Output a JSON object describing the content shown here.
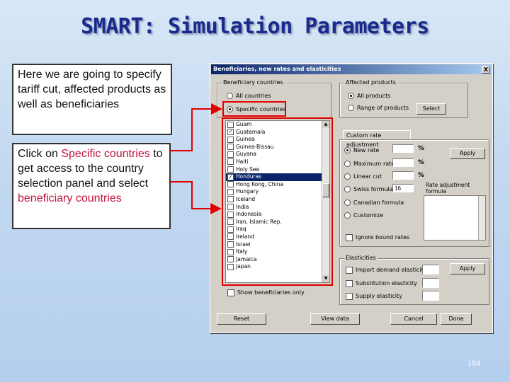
{
  "slide": {
    "title": "SMART: Simulation Parameters",
    "note1": "Here we are going to specify tariff cut, affected products as well as beneficiaries",
    "note2_parts": [
      "Click on ",
      "Specific countries",
      " to get access to the country selection panel and select ",
      "beneficiary countries"
    ],
    "page_number": "184"
  },
  "dialog": {
    "title": "Beneficiaries, new rates and elasticities",
    "beneficiary_group": {
      "label": "Beneficiary countries",
      "options": [
        "All countries",
        "Specific countries"
      ],
      "selected": "Specific countries"
    },
    "affected_group": {
      "label": "Affected products",
      "options": [
        "All products",
        "Range of products"
      ],
      "select_button": "Select"
    },
    "country_list": [
      {
        "name": "Guam",
        "checked": false
      },
      {
        "name": "Guatemala",
        "checked": true
      },
      {
        "name": "Guinea",
        "checked": false
      },
      {
        "name": "Guinea-Bissau",
        "checked": false
      },
      {
        "name": "Guyana",
        "checked": false
      },
      {
        "name": "Haiti",
        "checked": false
      },
      {
        "name": "Holy See",
        "checked": false
      },
      {
        "name": "Honduras",
        "checked": true,
        "selected": true
      },
      {
        "name": "Hong Kong, China",
        "checked": false
      },
      {
        "name": "Hungary",
        "checked": false
      },
      {
        "name": "Iceland",
        "checked": false
      },
      {
        "name": "India",
        "checked": false
      },
      {
        "name": "Indonesia",
        "checked": false
      },
      {
        "name": "Iran, Islamic Rep.",
        "checked": false
      },
      {
        "name": "Iraq",
        "checked": false
      },
      {
        "name": "Ireland",
        "checked": false
      },
      {
        "name": "Israel",
        "checked": false
      },
      {
        "name": "Italy",
        "checked": false
      },
      {
        "name": "Jamaica",
        "checked": false
      },
      {
        "name": "Japan",
        "checked": false
      }
    ],
    "show_beneficiaries_only": "Show beneficiaries only",
    "custom_tab": "Custom rate adjustment",
    "rate_options": [
      "New rate",
      "Maximum rate",
      "Linear cut",
      "Swiss formula",
      "Canadian formula",
      "Customize"
    ],
    "swiss_value": "16",
    "percent_sign": "%",
    "apply_label": "Apply",
    "rate_adjustment_label": "Rate adjustment formula",
    "ignore_bound_rates": "Ignore bound rates",
    "elasticities": {
      "label": "Elasticities",
      "items": [
        "Import demand elasticity",
        "Substitution elasticity",
        "Supply elasticity"
      ],
      "apply_label": "Apply"
    },
    "buttons": {
      "reset": "Reset",
      "view_data": "View data",
      "cancel": "Cancel",
      "done": "Done"
    },
    "close_glyph": "X"
  },
  "colors": {
    "title": "#1a2a8c",
    "highlight_red": "#e00000",
    "text_red": "#c0143c"
  }
}
